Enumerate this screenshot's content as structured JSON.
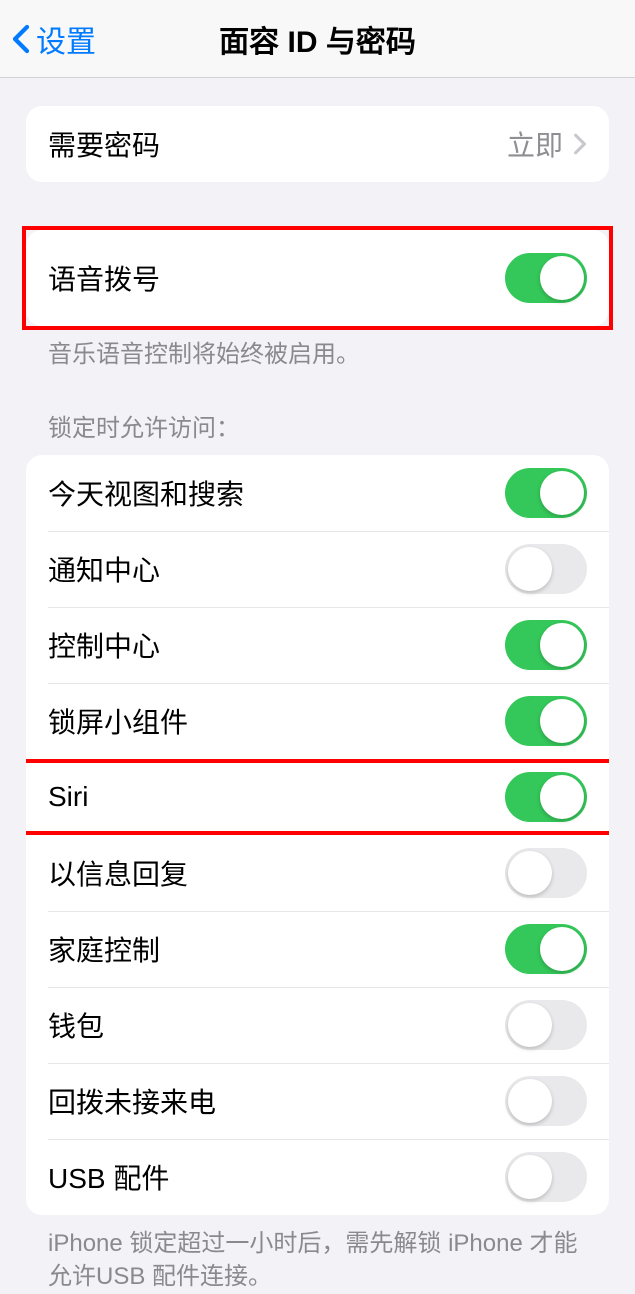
{
  "nav": {
    "back_label": "设置",
    "title": "面容 ID 与密码"
  },
  "passcode_group": {
    "require_passcode": {
      "label": "需要密码",
      "value": "立即"
    }
  },
  "voice_group": {
    "voice_dial": {
      "label": "语音拨号",
      "on": true
    },
    "footer": "音乐语音控制将始终被启用。"
  },
  "lock_access": {
    "header": "锁定时允许访问：",
    "items": [
      {
        "label": "今天视图和搜索",
        "on": true
      },
      {
        "label": "通知中心",
        "on": false
      },
      {
        "label": "控制中心",
        "on": true
      },
      {
        "label": "锁屏小组件",
        "on": true
      },
      {
        "label": "Siri",
        "on": true
      },
      {
        "label": "以信息回复",
        "on": false
      },
      {
        "label": "家庭控制",
        "on": true
      },
      {
        "label": "钱包",
        "on": false
      },
      {
        "label": "回拨未接来电",
        "on": false
      },
      {
        "label": "USB 配件",
        "on": false
      }
    ],
    "footer": "iPhone 锁定超过一小时后，需先解锁 iPhone 才能允许USB 配件连接。"
  }
}
